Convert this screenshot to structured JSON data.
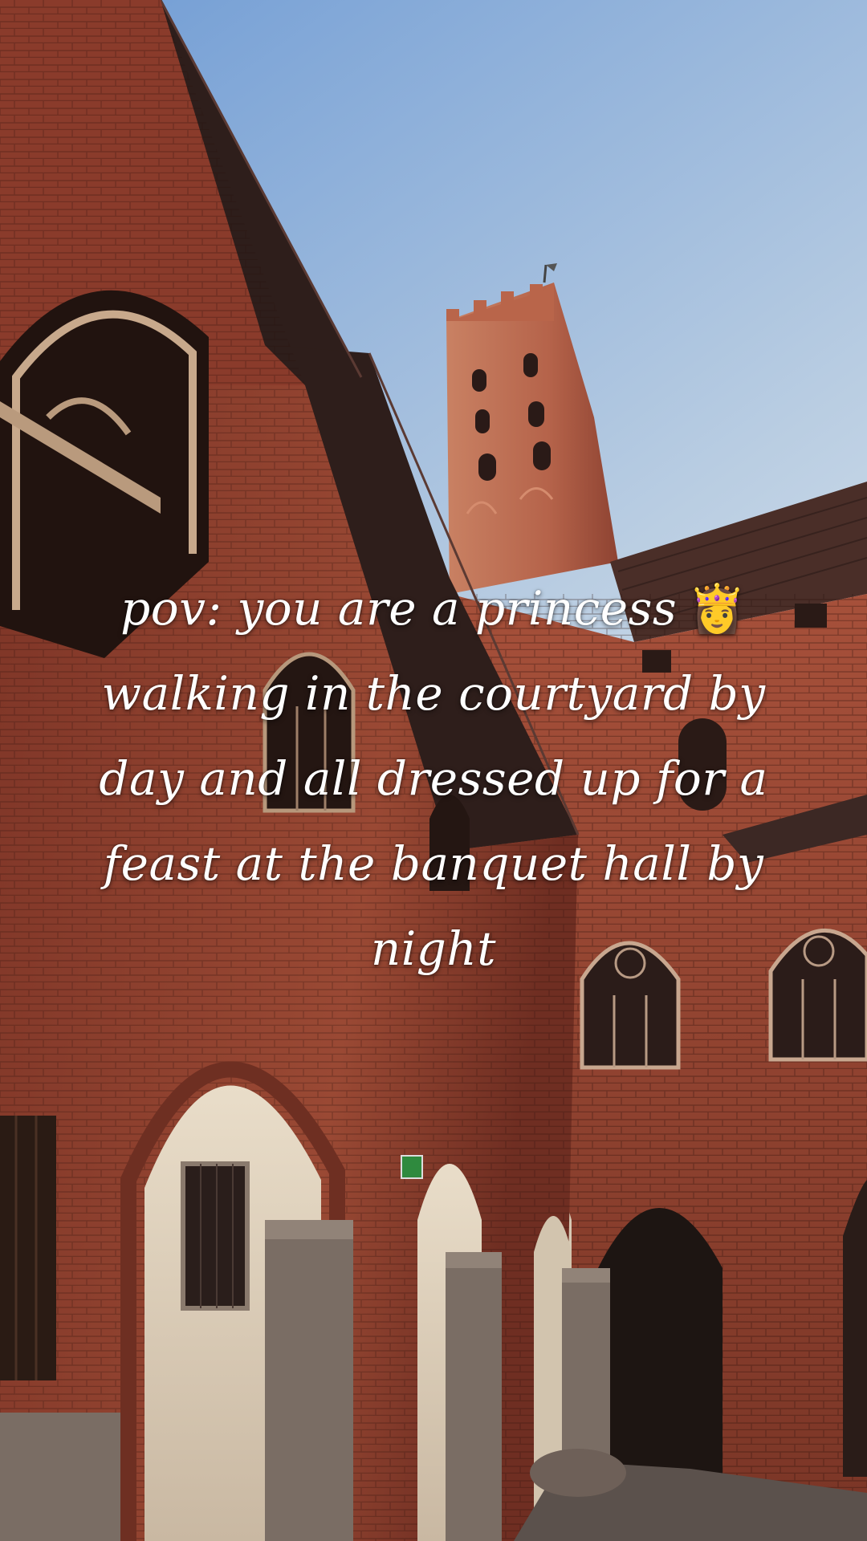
{
  "caption": {
    "lines": [
      "pov: you are a princess",
      "walking in the courtyard by",
      "day and all dressed up for a",
      "feast at the banquet hall by",
      "night"
    ],
    "emoji": "👸"
  },
  "colors": {
    "sky_top": "#7fa6d8",
    "sky_bottom": "#e4ecf3",
    "brick": "#8a3d2c",
    "brick_dark": "#5a2219",
    "brick_light": "#b5593f",
    "roof": "#3a2420",
    "tower": "#b96a4c",
    "arch_light": "#efe4d4",
    "stone": "#7b6c62",
    "window_dark": "#1e1512",
    "text": "#ffffff"
  }
}
